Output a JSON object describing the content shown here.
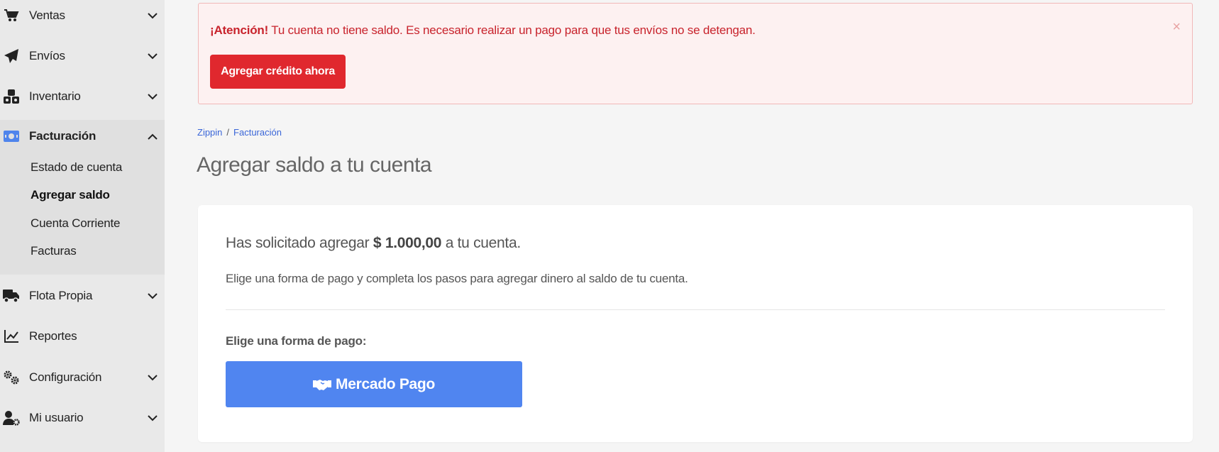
{
  "sidebar": {
    "items": [
      {
        "label": "Ventas",
        "icon": "cart-icon"
      },
      {
        "label": "Envíos",
        "icon": "paper-plane-icon"
      },
      {
        "label": "Inventario",
        "icon": "cubes-icon"
      },
      {
        "label": "Facturación",
        "icon": "money-bill-icon"
      },
      {
        "label": "Flota Propia",
        "icon": "truck-icon"
      },
      {
        "label": "Reportes",
        "icon": "line-chart-icon"
      },
      {
        "label": "Configuración",
        "icon": "cogs-icon"
      },
      {
        "label": "Mi usuario",
        "icon": "user-cog-icon"
      }
    ],
    "submenu": [
      "Estado de cuenta",
      "Agregar saldo",
      "Cuenta Corriente",
      "Facturas"
    ]
  },
  "alert": {
    "title": "¡Atención!",
    "message": "Tu cuenta no tiene saldo. Es necesario realizar un pago para que tus envíos no se detengan.",
    "close": "×",
    "button": "Agregar crédito ahora"
  },
  "breadcrumb": {
    "home": "Zippin",
    "separator": "/",
    "current": "Facturación"
  },
  "page": {
    "title": "Agregar saldo a tu cuenta"
  },
  "card": {
    "lead_before": "Has solicitado agregar",
    "amount": "$ 1.000,00",
    "lead_after": "a tu cuenta.",
    "description": "Elige una forma de pago y completa los pasos para agregar dinero al saldo de tu cuenta.",
    "choose_label": "Elige una forma de pago:",
    "payment_button": "Mercado Pago"
  },
  "colors": {
    "alert_red": "#e0282e",
    "accent_blue": "#5085f0",
    "link_blue": "#3a66d8"
  }
}
